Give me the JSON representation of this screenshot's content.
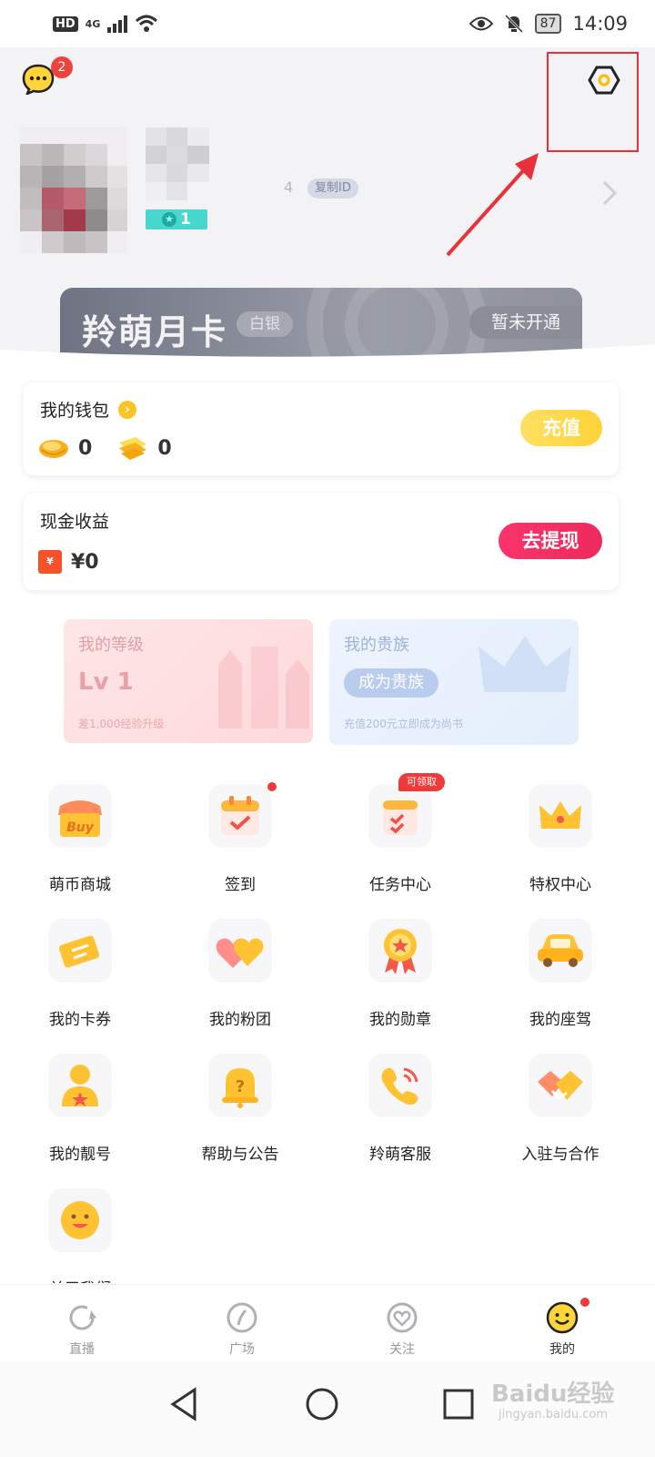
{
  "status_bar": {
    "hd": "HD",
    "network": "4G",
    "battery": "87",
    "time": "14:09"
  },
  "header": {
    "message_badge": "2",
    "id_tail": "4",
    "copy_id_label": "复制ID",
    "level_badge": "1"
  },
  "vip_card": {
    "title": "羚萌月卡",
    "tier": "白银",
    "status": "暂未开通"
  },
  "wallet": {
    "title": "我的钱包",
    "beans": "0",
    "coins": "0",
    "recharge_label": "充值"
  },
  "income": {
    "title": "现金收益",
    "amount": "¥0",
    "withdraw_label": "去提现"
  },
  "level_card": {
    "title": "我的等级",
    "level": "Lv 1",
    "note": "差1,000经验升级"
  },
  "noble_card": {
    "title": "我的贵族",
    "button": "成为贵族",
    "note": "充值200元立即成为尚书"
  },
  "grid": {
    "items": [
      {
        "label": "萌币商城"
      },
      {
        "label": "签到"
      },
      {
        "label": "任务中心",
        "tag": "可领取"
      },
      {
        "label": "特权中心"
      },
      {
        "label": "我的卡券"
      },
      {
        "label": "我的粉团"
      },
      {
        "label": "我的勋章"
      },
      {
        "label": "我的座驾"
      },
      {
        "label": "我的靓号"
      },
      {
        "label": "帮助与公告"
      },
      {
        "label": "羚萌客服"
      },
      {
        "label": "入驻与合作"
      },
      {
        "label": "关于我们"
      }
    ],
    "shop_icon_text": "Buy"
  },
  "bottom_nav": {
    "items": [
      {
        "label": "直播"
      },
      {
        "label": "广场"
      },
      {
        "label": "关注"
      },
      {
        "label": "我的"
      }
    ]
  },
  "watermark": {
    "brand": "Baidu经验",
    "url": "jingyan.baidu.com"
  },
  "colors": {
    "accent_yellow": "#ffd336",
    "accent_pink": "#f8336b",
    "badge_red": "#f0413f",
    "highlight_red": "#e8313b"
  }
}
